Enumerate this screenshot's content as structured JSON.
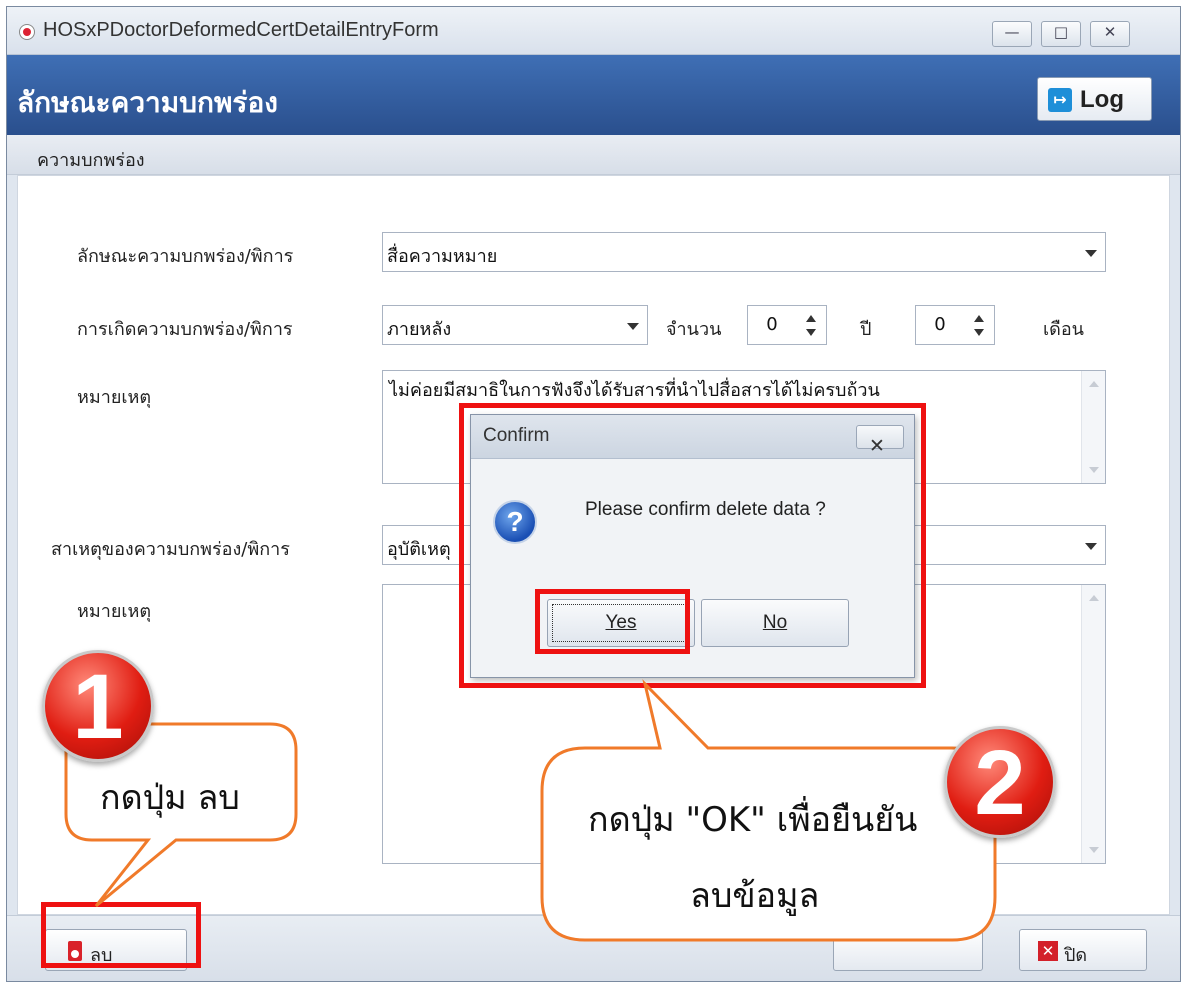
{
  "window": {
    "title": "HOSxPDoctorDeformedCertDetailEntryForm",
    "minimize_glyph": "—",
    "maximize_glyph": "□",
    "close_glyph": "✕"
  },
  "header": {
    "title": "ลักษณะความบกพร่อง",
    "log_label": "Log",
    "log_icon": "log-out-icon"
  },
  "group": {
    "label": "ความบกพร่อง"
  },
  "form": {
    "deformity_type_label": "ลักษณะความบกพร่อง/พิการ",
    "deformity_type_value": "สื่อความหมาย",
    "onset_label": "การเกิดความบกพร่อง/พิการ",
    "onset_value": "ภายหลัง",
    "amount_label": "จำนวน",
    "years_value": "0",
    "years_unit": "ปี",
    "months_value": "0",
    "months_unit": "เดือน",
    "note1_label": "หมายเหตุ",
    "note1_value": "ไม่ค่อยมีสมาธิในการฟังจึงได้รับสารที่นำไปสื่อสารได้ไม่ครบถ้วน",
    "cause_label": "สาเหตุของความบกพร่อง/พิการ",
    "cause_value": "อุบัติเหตุ",
    "note2_label": "หมายเหตุ",
    "note2_value": ""
  },
  "footer": {
    "delete_label": "ลบ",
    "close_label": "ปิด",
    "close_glyph": "✕"
  },
  "dialog": {
    "title": "Confirm",
    "close_glyph": "✕",
    "icon_glyph": "?",
    "message": "Please confirm delete data ?",
    "yes_label": "Yes",
    "no_label": "No"
  },
  "annotations": {
    "step1_number": "1",
    "step1_text": "กดปุ่ม ลบ",
    "step2_number": "2",
    "step2_line1": "กดปุ่ม \"OK\" เพื่อยืนยัน",
    "step2_line2": "ลบข้อมูล",
    "highlight_color": "#ee1111",
    "callout_border_color": "#f07a2a"
  },
  "colors": {
    "header_bg": "#2f5b9e",
    "form_bg": "#ffffff"
  }
}
